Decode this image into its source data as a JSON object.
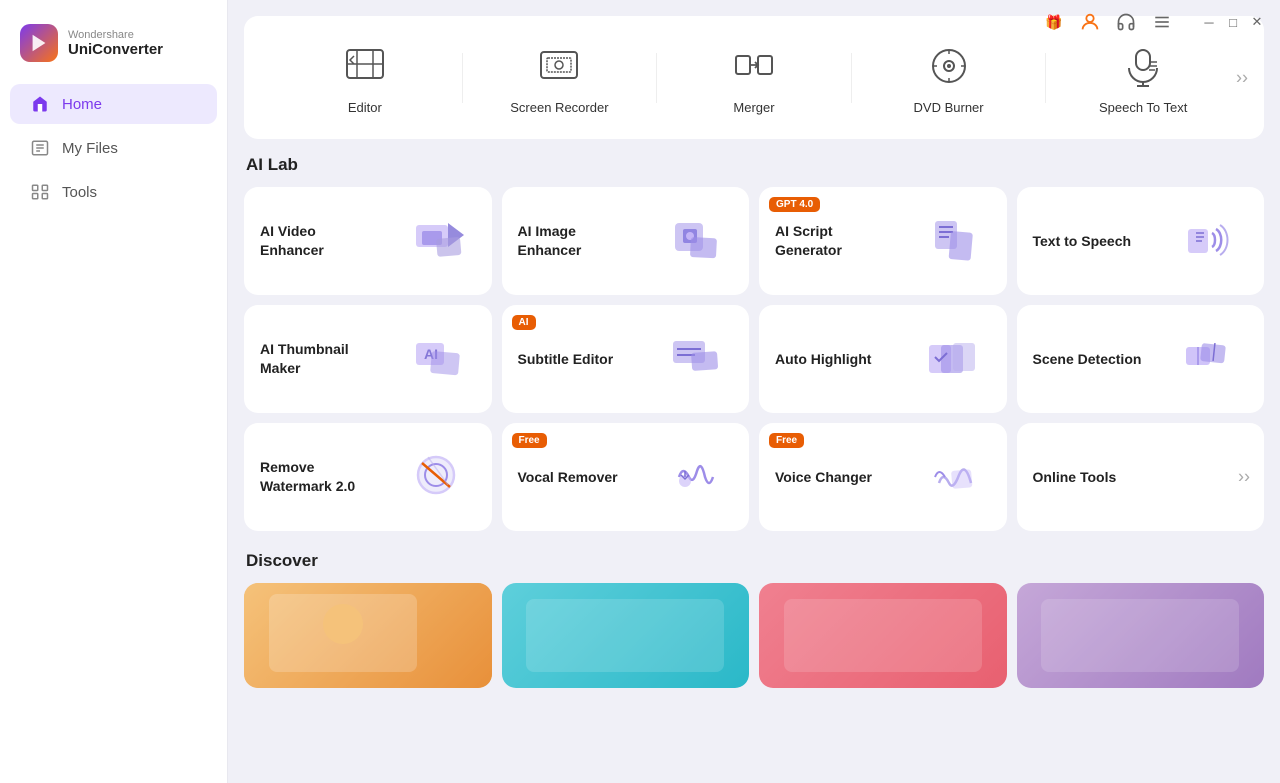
{
  "app": {
    "brand": "Wondershare",
    "product": "UniConverter"
  },
  "titlebar": {
    "icons": [
      "gift",
      "user",
      "headset",
      "menu",
      "minimize",
      "maximize",
      "close"
    ]
  },
  "sidebar": {
    "items": [
      {
        "id": "home",
        "label": "Home",
        "active": true
      },
      {
        "id": "myfiles",
        "label": "My Files",
        "active": false
      },
      {
        "id": "tools",
        "label": "Tools",
        "active": false
      }
    ]
  },
  "top_tools": {
    "items": [
      {
        "id": "editor",
        "label": "Editor"
      },
      {
        "id": "screen-recorder",
        "label": "Screen Recorder"
      },
      {
        "id": "merger",
        "label": "Merger"
      },
      {
        "id": "dvd-burner",
        "label": "DVD Burner"
      },
      {
        "id": "speech-to-text",
        "label": "Speech To Text"
      }
    ]
  },
  "ai_lab": {
    "section_title": "AI Lab",
    "items": [
      {
        "id": "ai-video-enhancer",
        "label": "AI Video\nEnhancer",
        "badge": null,
        "badge_text": ""
      },
      {
        "id": "ai-image-enhancer",
        "label": "AI Image\nEnhancer",
        "badge": null,
        "badge_text": ""
      },
      {
        "id": "ai-script-generator",
        "label": "AI Script\nGenerator",
        "badge": "gpt",
        "badge_text": "GPT 4.0"
      },
      {
        "id": "text-to-speech",
        "label": "Text to Speech",
        "badge": null,
        "badge_text": ""
      },
      {
        "id": "ai-thumbnail-maker",
        "label": "AI Thumbnail\nMaker",
        "badge": null,
        "badge_text": ""
      },
      {
        "id": "subtitle-editor",
        "label": "Subtitle Editor",
        "badge": "ai",
        "badge_text": "AI"
      },
      {
        "id": "auto-highlight",
        "label": "Auto Highlight",
        "badge": null,
        "badge_text": ""
      },
      {
        "id": "scene-detection",
        "label": "Scene Detection",
        "badge": null,
        "badge_text": ""
      },
      {
        "id": "remove-watermark",
        "label": "Remove\nWatermark 2.0",
        "badge": null,
        "badge_text": ""
      },
      {
        "id": "vocal-remover",
        "label": "Vocal Remover",
        "badge": "free",
        "badge_text": "Free"
      },
      {
        "id": "voice-changer",
        "label": "Voice Changer",
        "badge": "free",
        "badge_text": "Free"
      },
      {
        "id": "online-tools",
        "label": "Online Tools",
        "badge": null,
        "badge_text": "",
        "more": true
      }
    ]
  },
  "discover": {
    "section_title": "Discover",
    "items": [
      {
        "id": "discover-1",
        "bg": "#f5c27a"
      },
      {
        "id": "discover-2",
        "bg": "#5ecfdb"
      },
      {
        "id": "discover-3",
        "bg": "#e88ca0"
      },
      {
        "id": "discover-4",
        "bg": "#c5a7d8"
      }
    ]
  }
}
